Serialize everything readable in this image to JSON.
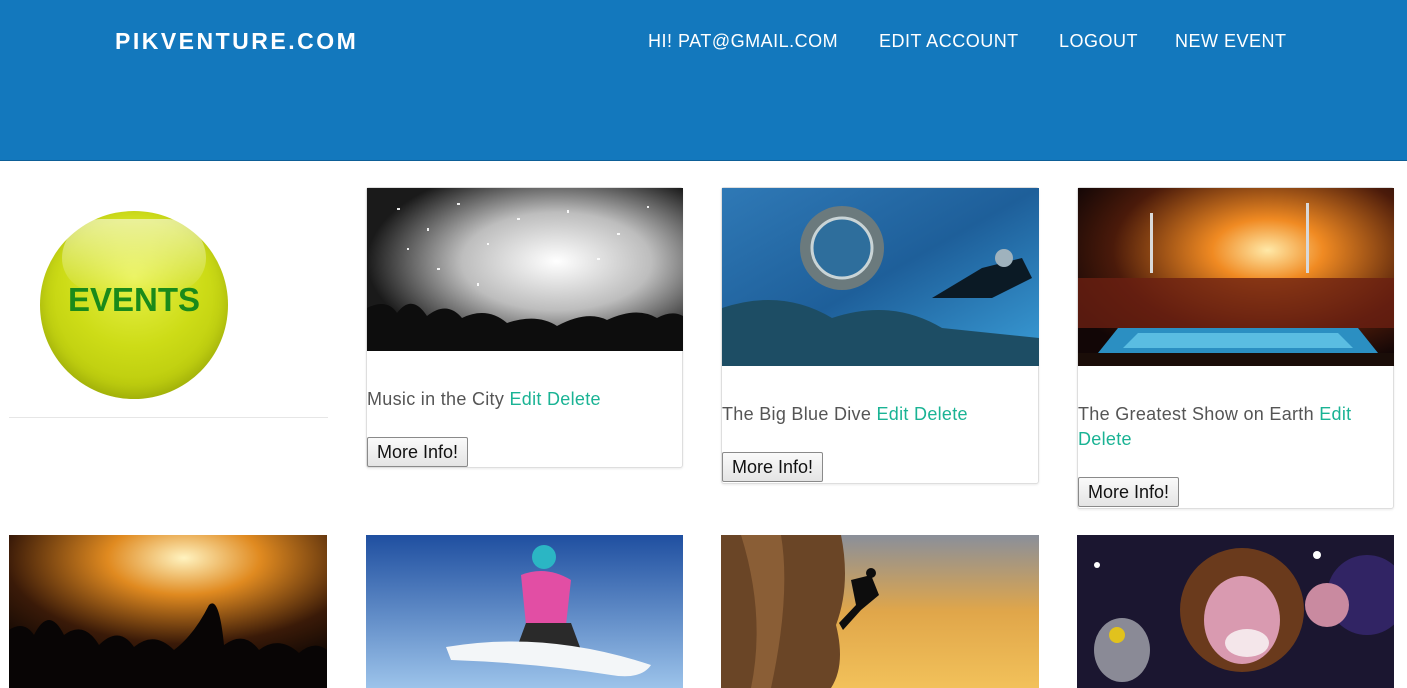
{
  "header": {
    "brand": "PIKVENTURE.COM",
    "nav": {
      "greeting": "HI! PAT@GMAIL.COM",
      "edit_account": "EDIT ACCOUNT",
      "logout": "LOGOUT",
      "new_event": "NEW EVENT"
    }
  },
  "sidebar": {
    "logo_text": "EVENTS"
  },
  "events": [
    {
      "title": "Music in the City",
      "edit": "Edit",
      "delete": "Delete",
      "more": "More Info!"
    },
    {
      "title": "The Big Blue Dive",
      "edit": "Edit",
      "delete": "Delete",
      "more": "More Info!"
    },
    {
      "title": "The Greatest Show on Earth",
      "edit": "Edit",
      "delete": "Delete",
      "more": "More Info!"
    }
  ],
  "colors": {
    "header": "#1378bd",
    "link": "#1ab394",
    "logo": "#cddc17"
  }
}
